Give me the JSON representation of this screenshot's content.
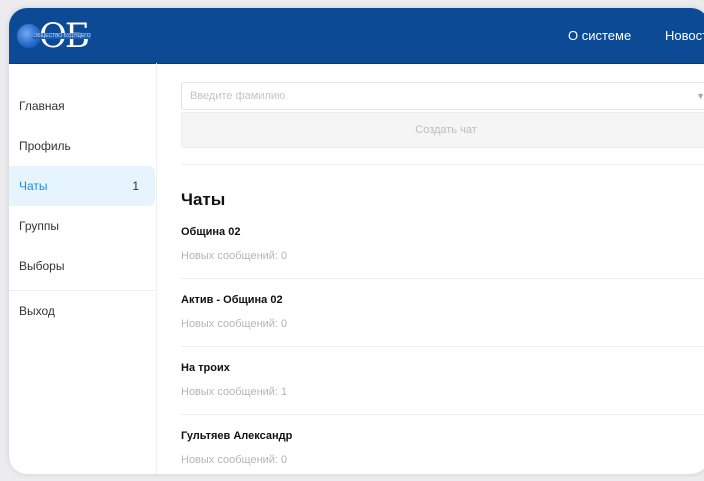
{
  "header": {
    "logo": {
      "letters": "ОБ",
      "tagline": "ОБЩЕСТВО БУДУЩЕГО"
    },
    "nav": [
      {
        "label": "О системе"
      },
      {
        "label": "Новости"
      }
    ],
    "colors": {
      "bar": "#0d4a96",
      "text": "#ffffff"
    }
  },
  "sidebar": {
    "items": [
      {
        "label": "Главная"
      },
      {
        "label": "Профиль"
      },
      {
        "label": "Чаты",
        "count": "1",
        "active": true
      },
      {
        "label": "Группы"
      },
      {
        "label": "Выборы"
      }
    ],
    "logout": "Выход",
    "active_color": "#1a8ed6"
  },
  "main": {
    "search": {
      "placeholder": "Введите фамилию"
    },
    "create_button": "Создать чат",
    "title": "Чаты",
    "chats": [
      {
        "name": "Община 02",
        "unread": "Новых сообщений: 0"
      },
      {
        "name": "Актив - Община 02",
        "unread": "Новых сообщений: 0"
      },
      {
        "name": "На троих",
        "unread": "Новых сообщений: 1"
      },
      {
        "name": "Гультяев Александр",
        "unread": "Новых сообщений: 0"
      }
    ]
  }
}
